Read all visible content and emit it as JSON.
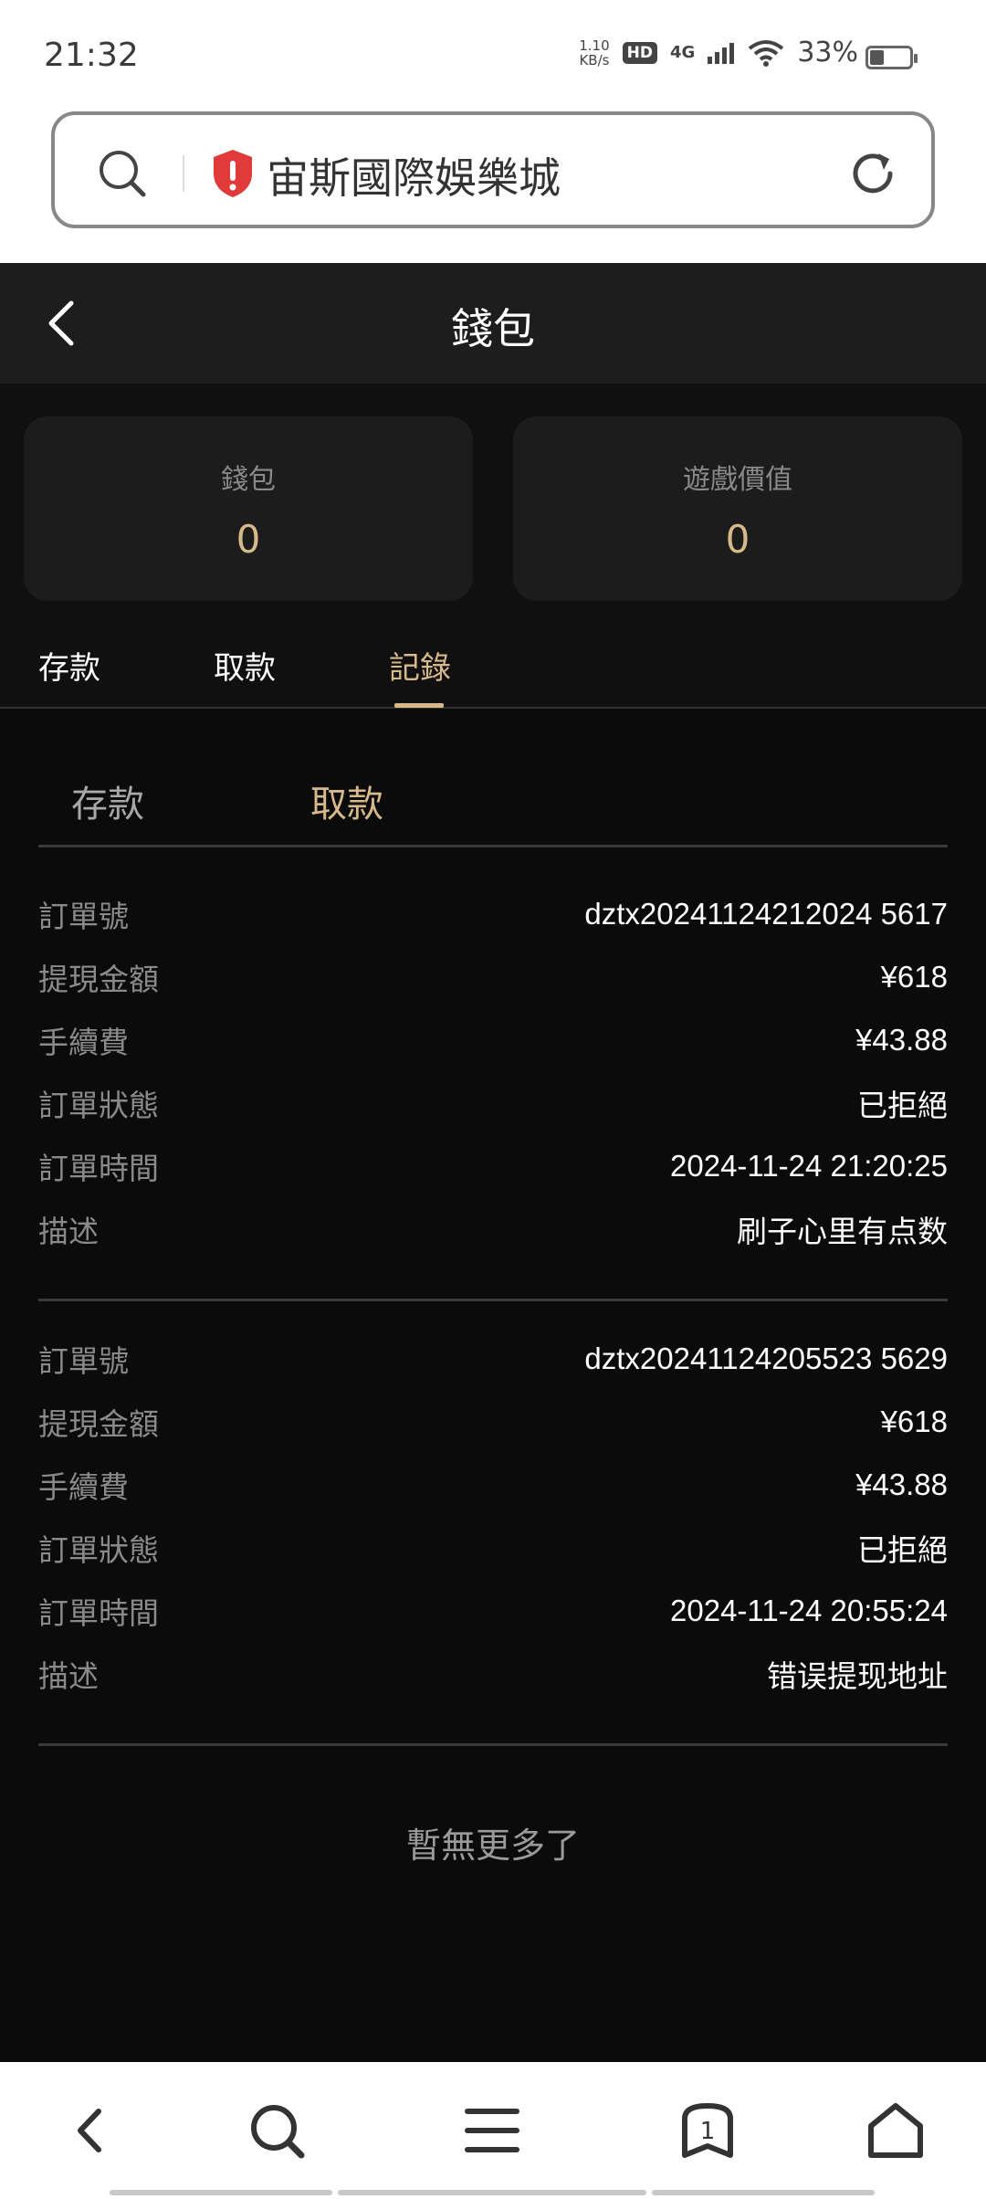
{
  "status": {
    "time": "21:32",
    "speed_top": "1.10",
    "speed_bottom": "KB/s",
    "hd": "HD",
    "network": "4G",
    "battery": "33%"
  },
  "browser": {
    "title": "宙斯國際娛樂城",
    "tab_count": "1"
  },
  "header": {
    "title": "錢包"
  },
  "cards": [
    {
      "label": "錢包",
      "value": "0"
    },
    {
      "label": "遊戲價值",
      "value": "0"
    }
  ],
  "main_tabs": [
    "存款",
    "取款",
    "記錄"
  ],
  "sub_tabs": [
    "存款",
    "取款"
  ],
  "records": [
    {
      "rows": [
        {
          "label": "訂單號",
          "value": "dztx20241124212024 5617"
        },
        {
          "label": "提現金額",
          "value": "¥618"
        },
        {
          "label": "手續費",
          "value": "¥43.88"
        },
        {
          "label": "訂單狀態",
          "value": "已拒絕"
        },
        {
          "label": "訂單時間",
          "value": "2024-11-24 21:20:25"
        },
        {
          "label": "描述",
          "value": "刷子心里有点数"
        }
      ]
    },
    {
      "rows": [
        {
          "label": "訂單號",
          "value": "dztx20241124205523 5629"
        },
        {
          "label": "提現金額",
          "value": "¥618"
        },
        {
          "label": "手續費",
          "value": "¥43.88"
        },
        {
          "label": "訂單狀態",
          "value": "已拒絕"
        },
        {
          "label": "訂單時間",
          "value": "2024-11-24 20:55:24"
        },
        {
          "label": "描述",
          "value": "错误提现地址"
        }
      ]
    }
  ],
  "footer_text": "暫無更多了",
  "colors": {
    "accent": "#d8b98a",
    "background": "#0b0b0b",
    "card": "#1c1c1c",
    "shield": "#e03a3a"
  },
  "icons": [
    "search-icon",
    "shield-alert-icon",
    "reload-icon",
    "back-arrow-icon",
    "nav-back-icon",
    "nav-search-icon",
    "nav-menu-icon",
    "nav-tabs-icon",
    "nav-home-icon"
  ]
}
